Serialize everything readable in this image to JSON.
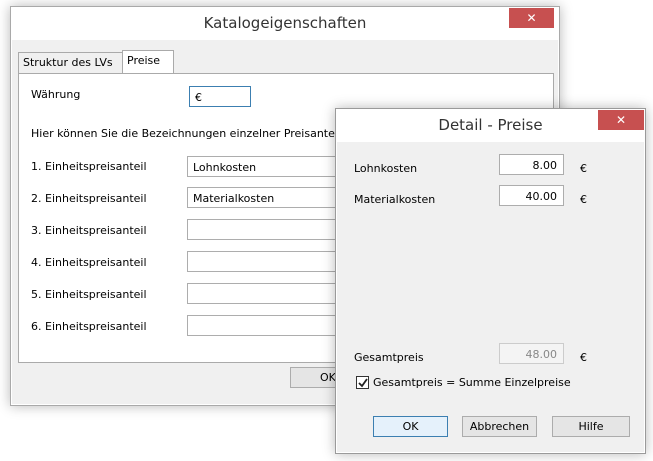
{
  "katalog": {
    "title": "Katalogeigenschaften",
    "close_glyph": "✕",
    "tabs": [
      {
        "label": "Struktur des LVs",
        "active": false
      },
      {
        "label": "Preise",
        "active": true
      }
    ],
    "waehrung_label": "Währung",
    "waehrung_value": "€",
    "info_text": "Hier können Sie die Bezeichnungen einzelner Preisanteile",
    "rows": [
      {
        "label": "1. Einheitspreisanteil",
        "value": "Lohnkosten"
      },
      {
        "label": "2. Einheitspreisanteil",
        "value": "Materialkosten"
      },
      {
        "label": "3. Einheitspreisanteil",
        "value": ""
      },
      {
        "label": "4. Einheitspreisanteil",
        "value": ""
      },
      {
        "label": "5. Einheitspreisanteil",
        "value": ""
      },
      {
        "label": "6. Einheitspreisanteil",
        "value": ""
      }
    ],
    "ok_label": "OK"
  },
  "detail": {
    "title": "Detail - Preise",
    "close_glyph": "✕",
    "items": [
      {
        "label": "Lohnkosten",
        "value": "8.00",
        "unit": "€"
      },
      {
        "label": "Materialkosten",
        "value": "40.00",
        "unit": "€"
      }
    ],
    "total_label": "Gesamtpreis",
    "total_value": "48.00",
    "total_unit": "€",
    "checkbox_label": "Gesamtpreis = Summe Einzelpreise",
    "checkbox_checked": true,
    "buttons": {
      "ok": "OK",
      "cancel": "Abbrechen",
      "help": "Hilfe"
    }
  },
  "colors": {
    "close_button": "#c75050",
    "accent_border": "#3c7fb1"
  }
}
